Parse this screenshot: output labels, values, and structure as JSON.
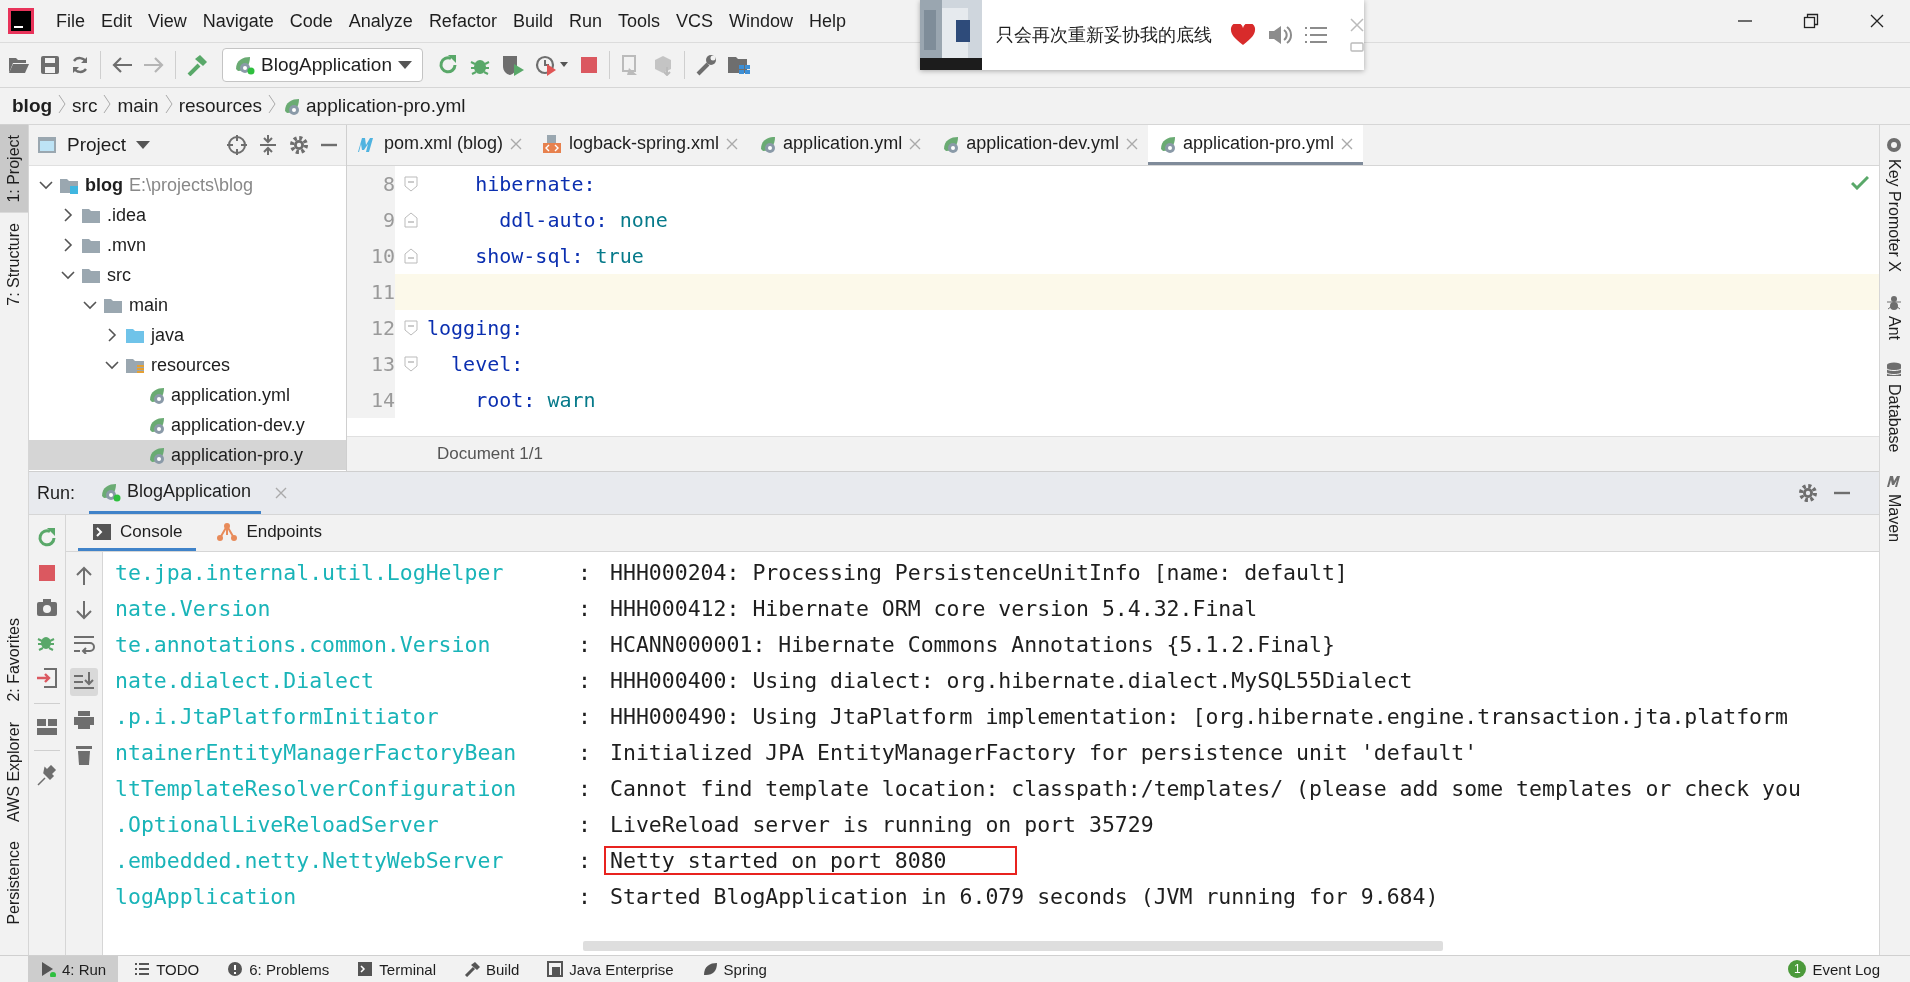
{
  "menu": [
    "File",
    "Edit",
    "View",
    "Navigate",
    "Code",
    "Analyze",
    "Refactor",
    "Build",
    "Run",
    "Tools",
    "VCS",
    "Window",
    "Help"
  ],
  "toolbar": {
    "run_configuration": "BlogApplication"
  },
  "breadcrumb": [
    {
      "label": "blog",
      "bold": true
    },
    {
      "label": "src",
      "bold": false
    },
    {
      "label": "main",
      "bold": false
    },
    {
      "label": "resources",
      "bold": false
    },
    {
      "label": "application-pro.yml",
      "bold": false,
      "kind": "yaml"
    }
  ],
  "music_popup": {
    "kind": "picture",
    "song": "只会再次重新妥协我的底线",
    "liked": true
  },
  "left_stripe": {
    "top": [
      {
        "label": "1: Project",
        "selected": true
      },
      {
        "label": "7: Structure",
        "selected": false
      }
    ],
    "bottom": [
      {
        "label": "2: Favorites"
      },
      {
        "label": "AWS Explorer"
      },
      {
        "label": "Persistence"
      }
    ]
  },
  "right_stripe": [
    "Key Promoter X",
    "Ant",
    "Database",
    "Maven"
  ],
  "project_panel": {
    "title": "Project"
  },
  "project_tree": [
    {
      "label": "blog",
      "path": "E:\\projects\\blog",
      "kind": "module",
      "expanded": true,
      "selected": false,
      "children": [
        {
          "label": ".idea",
          "kind": "folder",
          "expanded": false,
          "selected": false
        },
        {
          "label": ".mvn",
          "kind": "folder",
          "expanded": false,
          "selected": false
        },
        {
          "label": "src",
          "kind": "folder",
          "expanded": true,
          "selected": false,
          "children": [
            {
              "label": "main",
              "kind": "folder",
              "expanded": true,
              "selected": false,
              "children": [
                {
                  "label": "java",
                  "kind": "source",
                  "expanded": false,
                  "selected": false
                },
                {
                  "label": "resources",
                  "kind": "resources",
                  "expanded": true,
                  "selected": false,
                  "children": [
                    {
                      "label": "application.yml",
                      "kind": "yaml",
                      "selected": false
                    },
                    {
                      "label": "application-dev.y",
                      "kind": "yaml",
                      "selected": false
                    },
                    {
                      "label": "application-pro.y",
                      "kind": "yaml",
                      "selected": true
                    }
                  ]
                }
              ]
            }
          ]
        }
      ]
    }
  ],
  "editor_tabs": [
    {
      "label": "pom.xml (blog)",
      "kind": "maven",
      "selected": false
    },
    {
      "label": "logback-spring.xml",
      "kind": "xml",
      "selected": false
    },
    {
      "label": "application.yml",
      "kind": "yaml",
      "selected": false
    },
    {
      "label": "application-dev.yml",
      "kind": "yaml",
      "selected": false
    },
    {
      "label": "application-pro.yml",
      "kind": "yaml",
      "selected": true
    }
  ],
  "code_lines": [
    {
      "number": "8",
      "key": "    hibernate:",
      "kind": "fold-start",
      "current": false
    },
    {
      "number": "9",
      "key": "      ddl-auto:",
      "value": "none",
      "kind": "fold-end",
      "current": false
    },
    {
      "number": "10",
      "key": "    show-sql:",
      "value": "true",
      "kind": "fold-end",
      "current": false
    },
    {
      "number": "11",
      "kind": "plain",
      "current": true
    },
    {
      "number": "12",
      "key": "logging:",
      "kind": "fold-start",
      "current": false
    },
    {
      "number": "13",
      "key": "  level:",
      "kind": "fold-start",
      "current": false
    },
    {
      "number": "14",
      "key": "    root:",
      "value": "warn",
      "kind": "plain",
      "current": false
    }
  ],
  "editor_status": "Document 1/1",
  "run_panel": {
    "label": "Run:",
    "tab": "BlogApplication",
    "subtabs": [
      {
        "label": "Console",
        "selected": true
      },
      {
        "label": "Endpoints",
        "selected": false
      }
    ]
  },
  "console_lines": [
    {
      "logger": "te.jpa.internal.util.LogHelper",
      "separator": ":",
      "message": "HHH000204: Processing PersistenceUnitInfo [name: default]",
      "highlighted": false
    },
    {
      "logger": "nate.Version",
      "separator": ":",
      "message": "HHH000412: Hibernate ORM core version 5.4.32.Final",
      "highlighted": false
    },
    {
      "logger": "te.annotations.common.Version",
      "separator": ":",
      "message": "HCANN000001: Hibernate Commons Annotations {5.1.2.Final}",
      "highlighted": false
    },
    {
      "logger": "nate.dialect.Dialect",
      "separator": ":",
      "message": "HHH000400: Using dialect: org.hibernate.dialect.MySQL55Dialect",
      "highlighted": false
    },
    {
      "logger": ".p.i.JtaPlatformInitiator",
      "separator": ":",
      "message": "HHH000490: Using JtaPlatform implementation: [org.hibernate.engine.transaction.jta.platform",
      "highlighted": false
    },
    {
      "logger": "ntainerEntityManagerFactoryBean",
      "separator": ":",
      "message": "Initialized JPA EntityManagerFactory for persistence unit 'default'",
      "highlighted": false
    },
    {
      "logger": "ltTemplateResolverConfiguration",
      "separator": ":",
      "message": "Cannot find template location: classpath:/templates/ (please add some templates or check you",
      "highlighted": false
    },
    {
      "logger": ".OptionalLiveReloadServer",
      "separator": ":",
      "message": "LiveReload server is running on port 35729",
      "highlighted": false
    },
    {
      "logger": ".embedded.netty.NettyWebServer",
      "separator": ":",
      "message": "Netty started on port 8080",
      "highlighted": true
    },
    {
      "logger": "logApplication",
      "separator": ":",
      "message": "Started BlogApplication in 6.079 seconds (JVM running for 9.684)",
      "highlighted": false
    }
  ],
  "bottom_tabs": [
    {
      "label": "4: Run",
      "kind": "run",
      "selected": true
    },
    {
      "label": "TODO",
      "kind": "todo",
      "selected": false
    },
    {
      "label": "6: Problems",
      "kind": "problems",
      "selected": false
    },
    {
      "label": "Terminal",
      "kind": "terminal",
      "selected": false
    },
    {
      "label": "Build",
      "kind": "build",
      "selected": false
    },
    {
      "label": "Java Enterprise",
      "kind": "javaee",
      "selected": false
    },
    {
      "label": "Spring",
      "kind": "spring",
      "selected": false
    }
  ],
  "event_log": {
    "label": "Event Log",
    "count": "1"
  }
}
